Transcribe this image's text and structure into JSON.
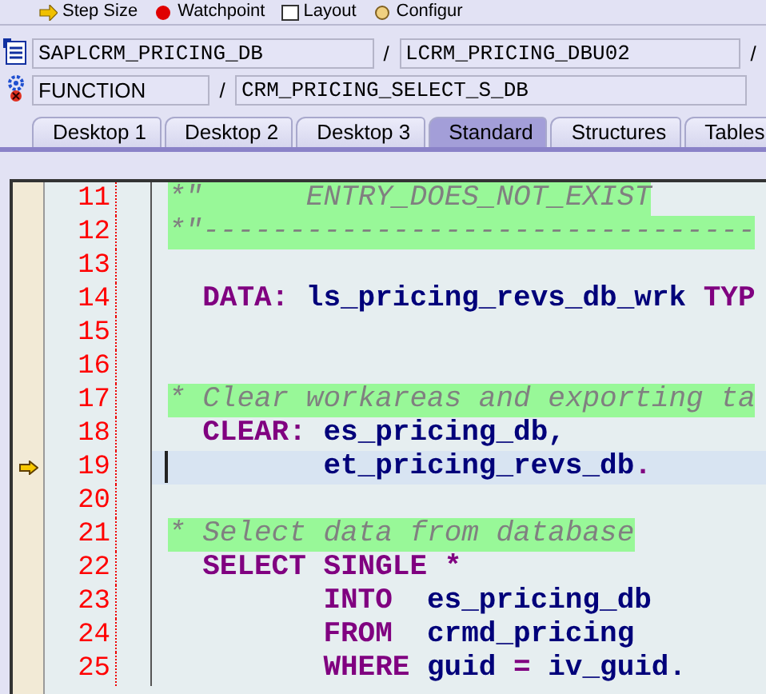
{
  "toolbar": [
    {
      "label": "Step Size"
    },
    {
      "label": "Watchpoint"
    },
    {
      "label": "Layout"
    },
    {
      "label": "Configur"
    }
  ],
  "program_row": {
    "program": "SAPLCRM_PRICING_DB",
    "separator": "/",
    "include": "LCRM_PRICING_DBU02",
    "trailing": "/"
  },
  "function_row": {
    "type": "FUNCTION",
    "separator": "/",
    "name": "CRM_PRICING_SELECT_S_DB"
  },
  "tabs": [
    {
      "label": "Desktop 1",
      "selected": false
    },
    {
      "label": "Desktop 2",
      "selected": false
    },
    {
      "label": "Desktop 3",
      "selected": false
    },
    {
      "label": "Standard",
      "selected": true
    },
    {
      "label": "Structures",
      "selected": false
    },
    {
      "label": "Tables",
      "selected": false
    }
  ],
  "editor": {
    "lines": [
      {
        "number": "11",
        "kind": "comment",
        "current": false,
        "segments": [
          {
            "kind": "comment",
            "text": "*\"      ENTRY_DOES_NOT_EXIST"
          }
        ]
      },
      {
        "number": "12",
        "kind": "comment",
        "current": false,
        "segments": [
          {
            "kind": "comment",
            "text": "*\"--------------------------------"
          }
        ]
      },
      {
        "number": "13",
        "kind": "blank",
        "current": false
      },
      {
        "number": "14",
        "kind": "statement",
        "current": false,
        "segments": [
          {
            "kind": "keyword",
            "text": "DATA: "
          },
          {
            "kind": "ident",
            "text": "ls_pricing_revs_db_wrk "
          },
          {
            "kind": "keyword",
            "text": "TYP"
          }
        ]
      },
      {
        "number": "15",
        "kind": "blank",
        "current": false
      },
      {
        "number": "16",
        "kind": "blank",
        "current": false
      },
      {
        "number": "17",
        "kind": "comment",
        "current": false,
        "segments": [
          {
            "kind": "comment",
            "text": "* Clear workareas and exporting ta"
          }
        ]
      },
      {
        "number": "18",
        "kind": "statement",
        "current": false,
        "segments": [
          {
            "kind": "keyword",
            "text": "CLEAR: "
          },
          {
            "kind": "ident",
            "text": "es_pricing_db,"
          }
        ]
      },
      {
        "number": "19",
        "kind": "continuation",
        "current": true,
        "segments": [
          {
            "kind": "ident",
            "text": "et_pricing_revs_db"
          },
          {
            "kind": "keyword",
            "text": "."
          }
        ]
      },
      {
        "number": "20",
        "kind": "blank",
        "current": false
      },
      {
        "number": "21",
        "kind": "comment",
        "current": false,
        "segments": [
          {
            "kind": "comment",
            "text": "* Select data from database"
          }
        ]
      },
      {
        "number": "22",
        "kind": "statement",
        "current": false,
        "segments": [
          {
            "kind": "keyword",
            "text": "SELECT SINGLE *"
          }
        ]
      },
      {
        "number": "23",
        "kind": "continuation",
        "current": false,
        "segments": [
          {
            "kind": "keyword",
            "text": "INTO  "
          },
          {
            "kind": "ident",
            "text": "es_pricing_db"
          }
        ]
      },
      {
        "number": "24",
        "kind": "continuation",
        "current": false,
        "segments": [
          {
            "kind": "keyword",
            "text": "FROM  "
          },
          {
            "kind": "ident",
            "text": "crmd_pricing"
          }
        ]
      },
      {
        "number": "25",
        "kind": "continuation",
        "current": false,
        "segments": [
          {
            "kind": "keyword",
            "text": "WHERE "
          },
          {
            "kind": "ident",
            "text": "guid "
          },
          {
            "kind": "keyword",
            "text": "= "
          },
          {
            "kind": "ident",
            "text": "iv_guid."
          }
        ]
      }
    ]
  }
}
